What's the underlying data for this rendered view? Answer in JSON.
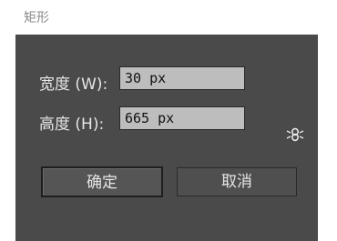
{
  "window": {
    "title": "矩形"
  },
  "fields": {
    "width_label": "宽度 (W):",
    "width_value": "30 px",
    "height_label": "高度 (H):",
    "height_value": "665 px"
  },
  "icons": {
    "constrain_proportions": "link-icon"
  },
  "buttons": {
    "ok_label": "确定",
    "cancel_label": "取消"
  },
  "colors": {
    "dialog_background": "#4a4a4a",
    "field_background": "#bdbdbd",
    "text": "#e6e6e6"
  }
}
